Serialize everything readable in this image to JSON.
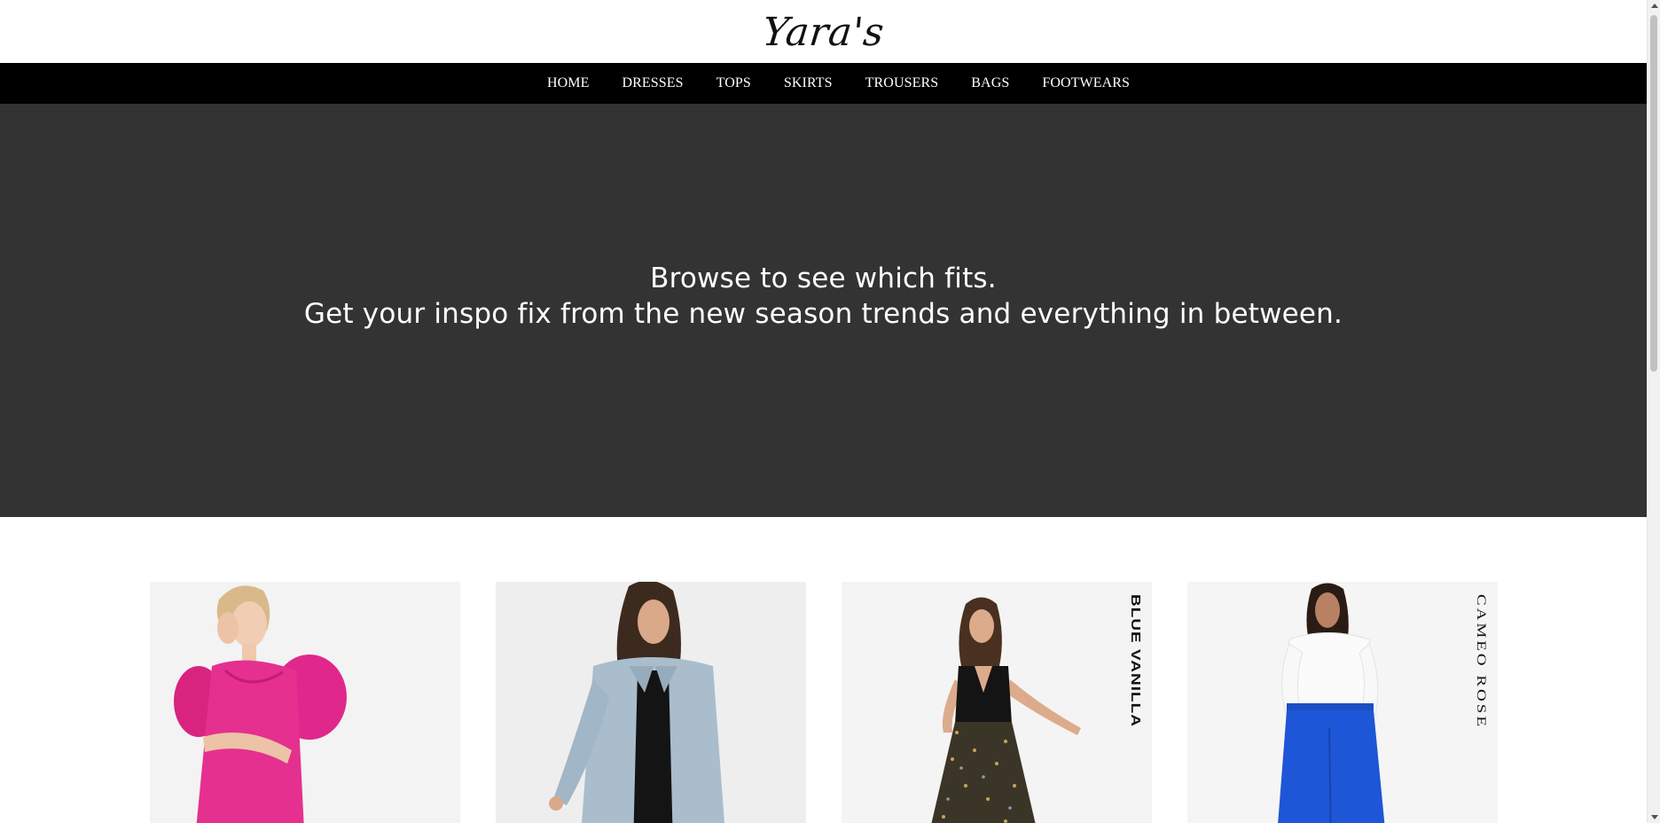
{
  "header": {
    "brand": "Yara's"
  },
  "nav": {
    "items": [
      {
        "label": "HOME"
      },
      {
        "label": "DRESSES"
      },
      {
        "label": "TOPS"
      },
      {
        "label": "SKIRTS"
      },
      {
        "label": "TROUSERS"
      },
      {
        "label": "BAGS"
      },
      {
        "label": "FOOTWEARS"
      }
    ]
  },
  "hero": {
    "line1": "Browse to see which fits.",
    "line2": "Get your inspo fix from the new season trends and everything in between.",
    "background": "#333333"
  },
  "products": [
    {
      "image": "woman-in-pink-puff-sleeve-dress",
      "tag": ""
    },
    {
      "image": "woman-in-light-blue-shirt-jacket",
      "tag": ""
    },
    {
      "image": "woman-in-black-waistcoat-floral-skirt",
      "tag": "BLUE VANILLA"
    },
    {
      "image": "woman-in-white-shirt-blue-trousers",
      "tag": "CAMEO ROSE"
    }
  ],
  "colors": {
    "nav_bg": "#000000",
    "hero_bg": "#333333",
    "text_light": "#ffffff"
  }
}
